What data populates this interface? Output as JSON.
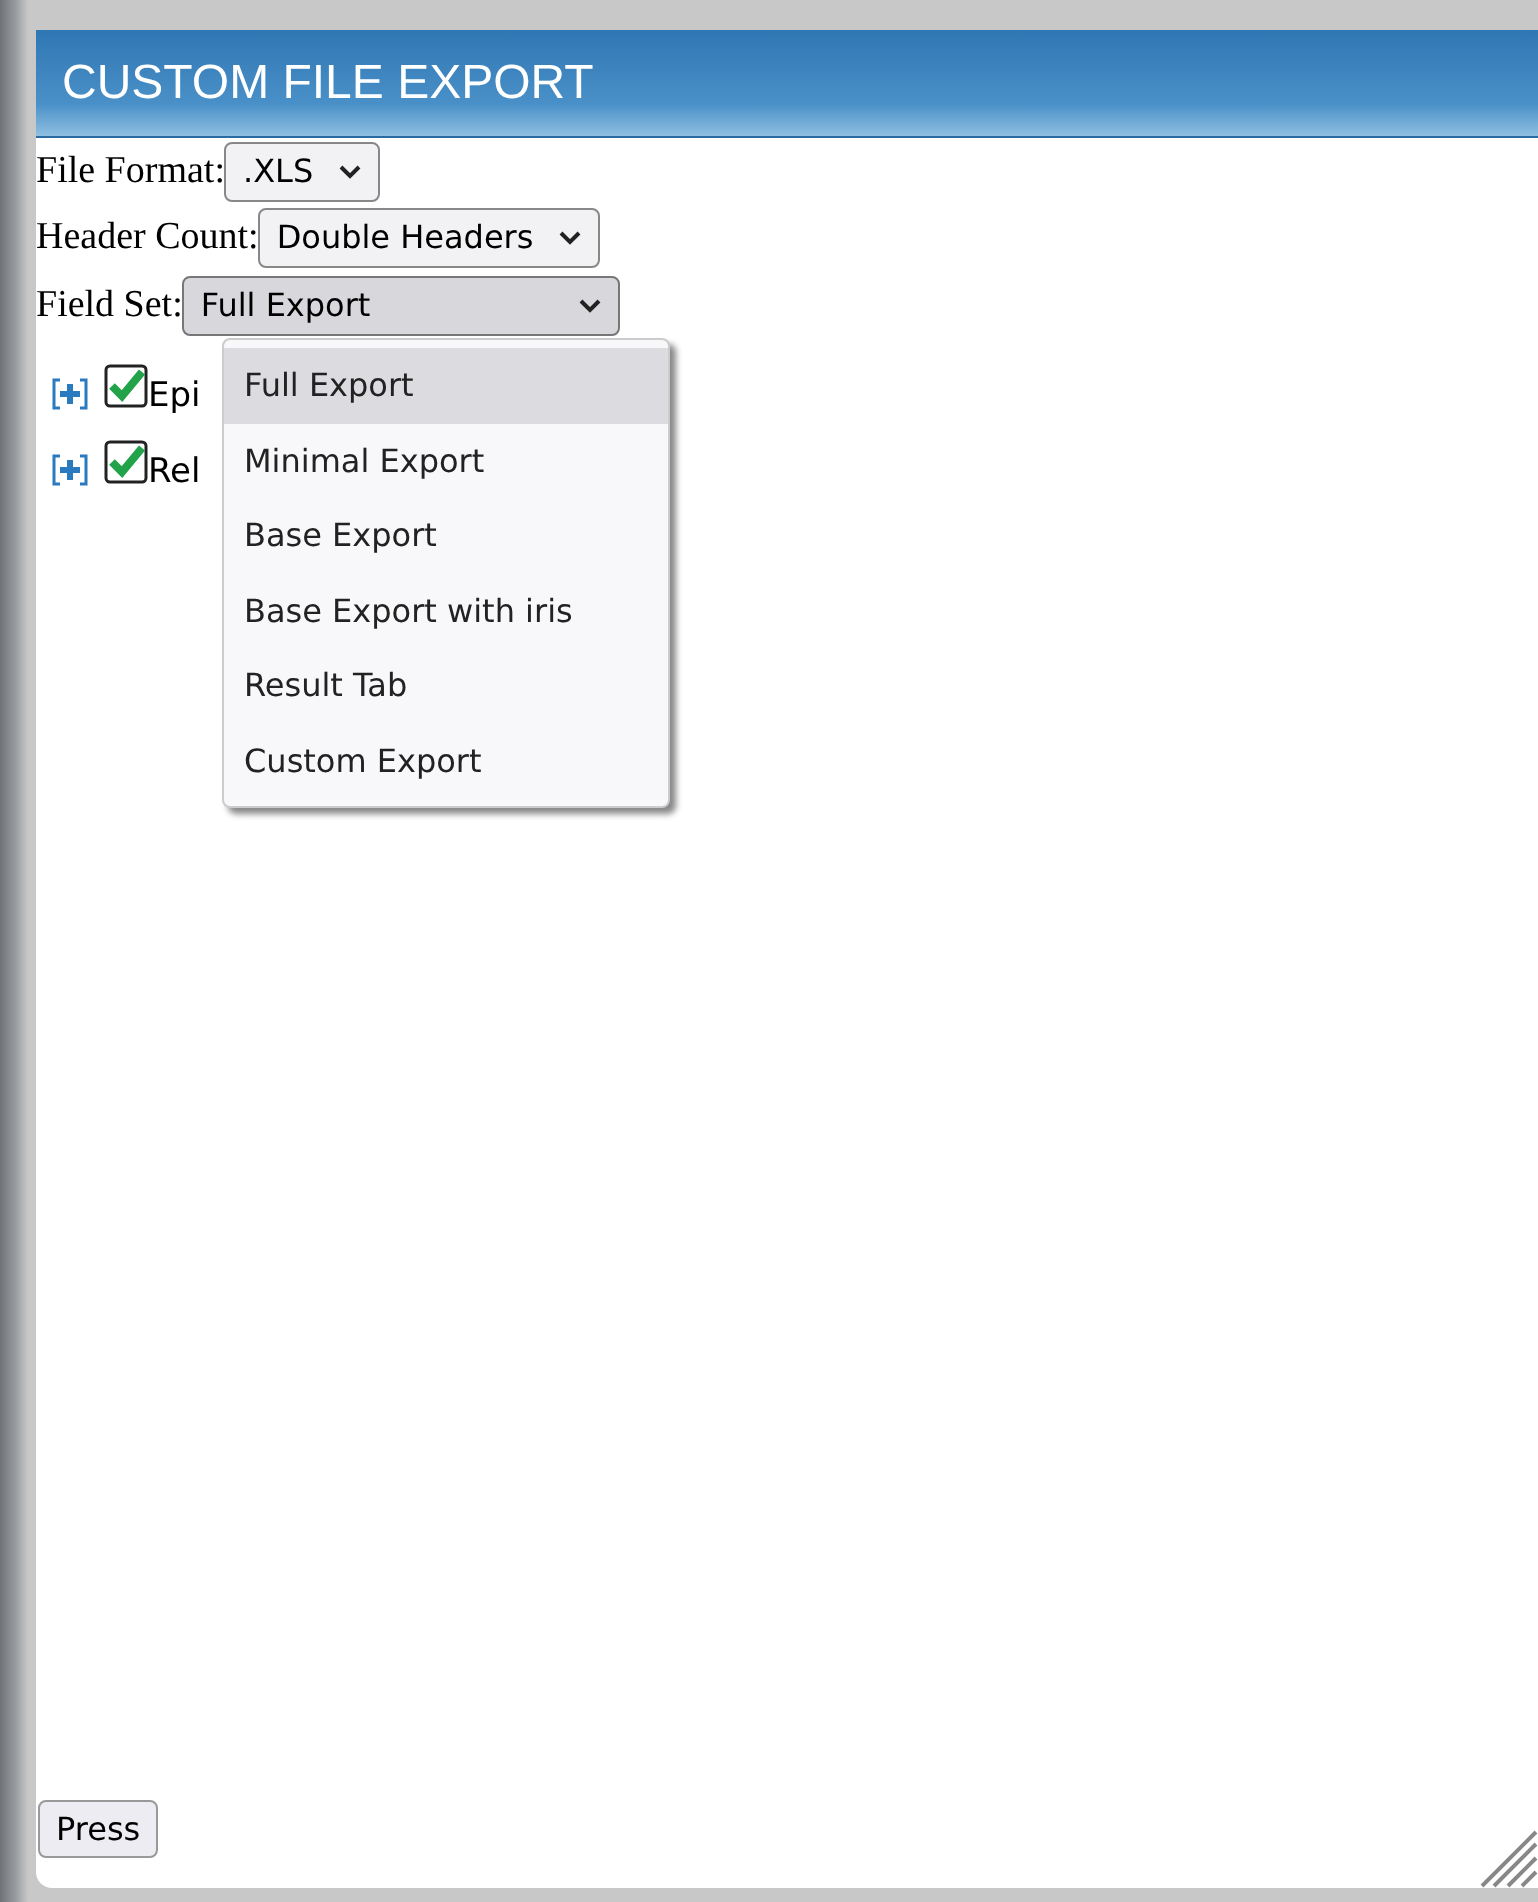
{
  "window": {
    "title": "CUSTOM FILE EXPORT"
  },
  "fields": [
    {
      "label": "File Format:",
      "value": ".XLS",
      "open": false
    },
    {
      "label": "Header Count:",
      "value": "Double Headers",
      "open": false
    },
    {
      "label": "Field Set:",
      "value": "Full Export",
      "open": true
    }
  ],
  "tree": [
    {
      "label": "Epi",
      "checked": true,
      "expanded": false
    },
    {
      "label": "Rel",
      "checked": true,
      "expanded": false
    }
  ],
  "field_set_options": [
    {
      "label": "Full Export",
      "selected": true
    },
    {
      "label": "Minimal Export",
      "selected": false
    },
    {
      "label": "Base Export",
      "selected": false
    },
    {
      "label": "Base Export with iris",
      "selected": false
    },
    {
      "label": "Result Tab",
      "selected": false
    },
    {
      "label": "Custom Export",
      "selected": false
    }
  ],
  "button": "Press"
}
